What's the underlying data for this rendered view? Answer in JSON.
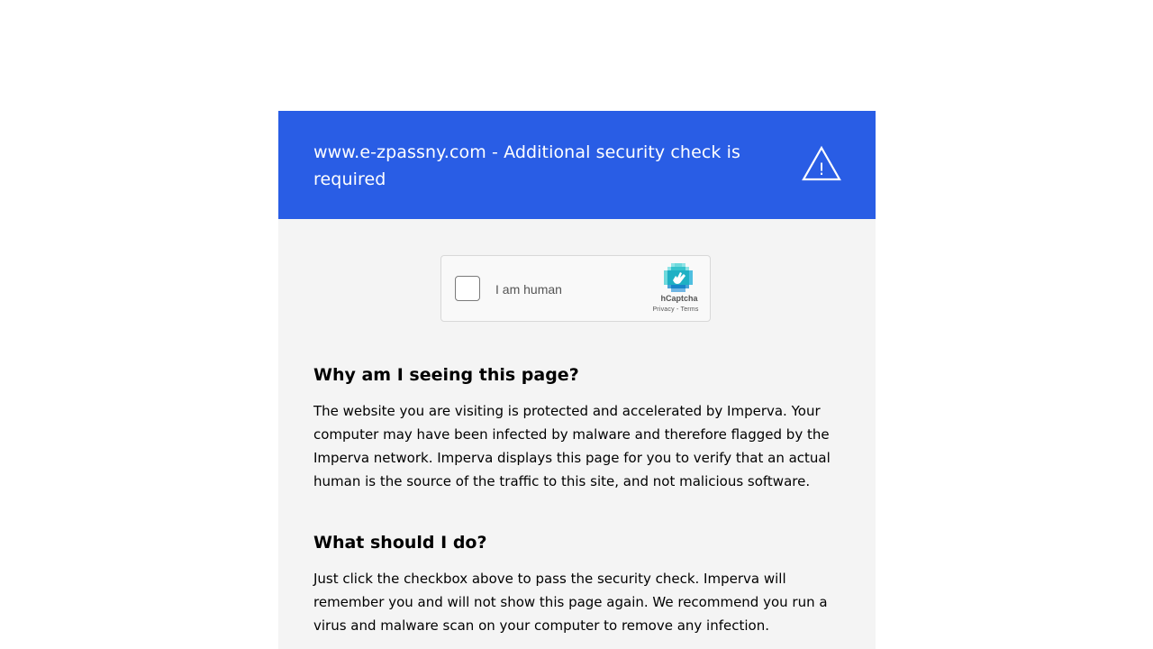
{
  "banner": {
    "title": "www.e-zpassny.com - Additional security check is required",
    "icon": "warning-icon",
    "background": "#295de5"
  },
  "captcha": {
    "label": "I am human",
    "brand": "hCaptcha",
    "privacy_link": "Privacy",
    "separator": " - ",
    "terms_link": "Terms",
    "checked": false
  },
  "why": {
    "heading": "Why am I seeing this page?",
    "body": "The website you are visiting is protected and accelerated by Imperva. Your computer may have been infected by malware and therefore flagged by the Imperva network. Imperva displays this page for you to verify that an actual human is the source of the traffic to this site, and not malicious software."
  },
  "what": {
    "heading": "What should I do?",
    "body": "Just click the checkbox above to pass the security check. Imperva will remember you and will not show this page again. We recommend you run a virus and malware scan on your computer to remove any infection."
  }
}
